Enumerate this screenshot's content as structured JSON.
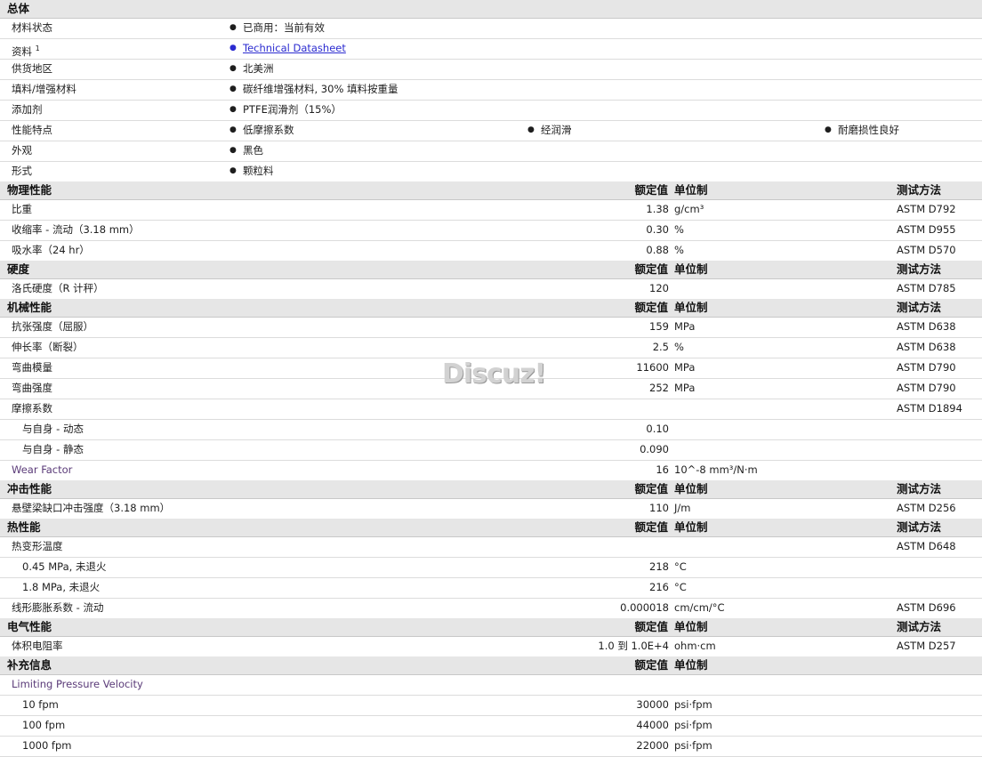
{
  "general": {
    "title": "总体",
    "rows": [
      {
        "label": "材料状态",
        "items": [
          "已商用：当前有效"
        ]
      },
      {
        "label": "资料",
        "sup": "1",
        "items": [
          "Technical Datasheet"
        ],
        "link": true
      },
      {
        "label": "供货地区",
        "items": [
          "北美洲"
        ]
      },
      {
        "label": "填料/增强材料",
        "items": [
          "碳纤维增强材料, 30% 填料按重量"
        ]
      },
      {
        "label": "添加剂",
        "items": [
          "PTFE润滑剂（15%）"
        ]
      },
      {
        "label": "性能特点",
        "items": [
          "低摩擦系数",
          "经润滑",
          "耐磨损性良好"
        ]
      },
      {
        "label": "外观",
        "items": [
          "黑色"
        ]
      },
      {
        "label": "形式",
        "items": [
          "颗粒料"
        ]
      }
    ]
  },
  "headers": {
    "value": "额定值",
    "unit": "单位制",
    "method": "测试方法"
  },
  "sections": [
    {
      "title": "物理性能",
      "rows": [
        {
          "label": "比重",
          "value": "1.38",
          "unit": "g/cm³",
          "method": "ASTM D792"
        },
        {
          "label": "收缩率 - 流动（3.18 mm）",
          "value": "0.30",
          "unit": "%",
          "method": "ASTM D955"
        },
        {
          "label": "吸水率（24 hr）",
          "value": "0.88",
          "unit": "%",
          "method": "ASTM D570"
        }
      ]
    },
    {
      "title": "硬度",
      "rows": [
        {
          "label": "洛氏硬度（R 计秤）",
          "value": "120",
          "unit": "",
          "method": "ASTM D785"
        }
      ]
    },
    {
      "title": "机械性能",
      "rows": [
        {
          "label": "抗张强度（屈服）",
          "value": "159",
          "unit": "MPa",
          "method": "ASTM D638"
        },
        {
          "label": "伸长率（断裂）",
          "value": "2.5",
          "unit": "%",
          "method": "ASTM D638"
        },
        {
          "label": "弯曲模量",
          "value": "11600",
          "unit": "MPa",
          "method": "ASTM D790"
        },
        {
          "label": "弯曲强度",
          "value": "252",
          "unit": "MPa",
          "method": "ASTM D790"
        },
        {
          "label": "摩擦系数",
          "value": "",
          "unit": "",
          "method": "ASTM D1894"
        },
        {
          "label": "与自身 - 动态",
          "value": "0.10",
          "unit": "",
          "method": "",
          "indent": true
        },
        {
          "label": "与自身 - 静态",
          "value": "0.090",
          "unit": "",
          "method": "",
          "indent": true
        },
        {
          "label": "Wear Factor",
          "value": "16",
          "unit": "10^-8 mm³/N·m",
          "method": "",
          "purple": true
        }
      ]
    },
    {
      "title": "冲击性能",
      "rows": [
        {
          "label": "悬壁梁缺口冲击强度（3.18 mm）",
          "value": "110",
          "unit": "J/m",
          "method": "ASTM D256"
        }
      ]
    },
    {
      "title": "热性能",
      "rows": [
        {
          "label": "热变形温度",
          "value": "",
          "unit": "",
          "method": "ASTM D648"
        },
        {
          "label": "0.45 MPa, 未退火",
          "value": "218",
          "unit": "°C",
          "method": "",
          "indent": true
        },
        {
          "label": "1.8 MPa, 未退火",
          "value": "216",
          "unit": "°C",
          "method": "",
          "indent": true
        },
        {
          "label": "线形膨胀系数 - 流动",
          "value": "0.000018",
          "unit": "cm/cm/°C",
          "method": "ASTM D696"
        }
      ]
    },
    {
      "title": "电气性能",
      "rows": [
        {
          "label": "体积电阻率",
          "value": "1.0 到  1.0E+4",
          "unit": "ohm·cm",
          "method": "ASTM D257"
        }
      ]
    },
    {
      "title": "补充信息",
      "no_method": true,
      "rows": [
        {
          "label": "Limiting Pressure Velocity",
          "value": "",
          "unit": "",
          "method": "",
          "purple": true
        },
        {
          "label": "10 fpm",
          "value": "30000",
          "unit": "psi·fpm",
          "method": "",
          "indent": true
        },
        {
          "label": "100 fpm",
          "value": "44000",
          "unit": "psi·fpm",
          "method": "",
          "indent": true
        },
        {
          "label": "1000 fpm",
          "value": "22000",
          "unit": "psi·fpm",
          "method": "",
          "indent": true
        }
      ]
    }
  ],
  "watermark": "Discuz!"
}
